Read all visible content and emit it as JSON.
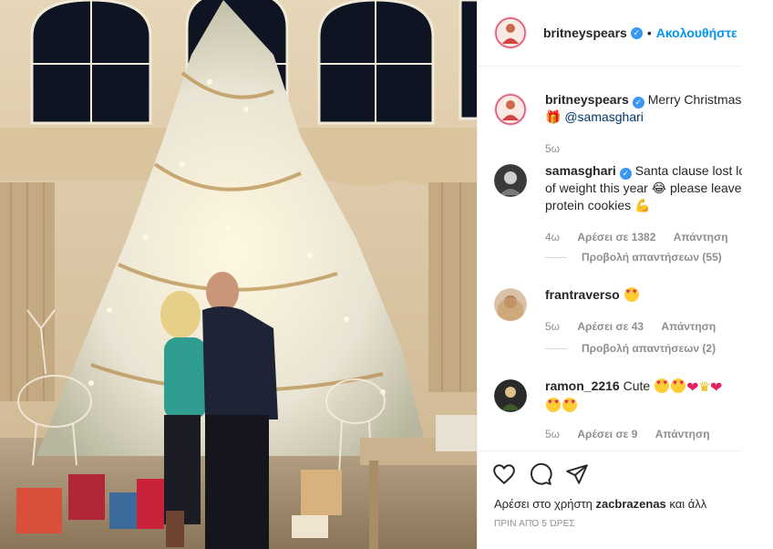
{
  "post": {
    "author": "britneyspears",
    "follow_label": "Ακολουθήστε",
    "separator": "•"
  },
  "comments": [
    {
      "user": "britneyspears",
      "text": "Merry Christmas",
      "mention": "@samasghari",
      "gift_emoji": "🎁",
      "time": "5ω"
    },
    {
      "user": "samasghari",
      "text": "Santa clause lost lot of weight this year 😂 please leave protein cookies 💪",
      "time": "4ω",
      "likes": "Αρέσει σε 1382",
      "reply": "Απάντηση",
      "view_replies": "Προβολή απαντήσεων (55)"
    },
    {
      "user": "frantraverso",
      "time": "5ω",
      "likes": "Αρέσει σε 43",
      "reply": "Απάντηση",
      "view_replies": "Προβολή απαντήσεων (2)"
    },
    {
      "user": "ramon_2216",
      "text": "Cute",
      "time": "5ω",
      "likes": "Αρέσει σε 9",
      "reply": "Απάντηση"
    }
  ],
  "actions": {
    "likes_prefix": "Αρέσει στο χρήστη",
    "likes_user": "zacbrazenas",
    "likes_suffix": "και άλλ",
    "time_ago": "ΠΡΙΝ ΑΠΌ 5 ΏΡΕΣ"
  },
  "colors": {
    "link": "#0095f6",
    "verified": "#3897f0",
    "muted": "#8e8e8e",
    "text": "#262626"
  }
}
